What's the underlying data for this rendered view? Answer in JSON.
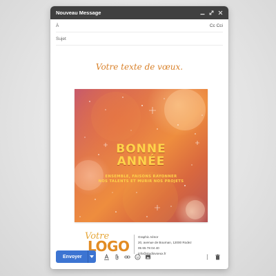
{
  "window": {
    "title": "Nouveau Message",
    "controls": [
      "minimize-icon",
      "expand-icon",
      "close-icon"
    ]
  },
  "fields": {
    "to_label": "À",
    "cc_label": "Cc Cci",
    "subject_label": "Sujet"
  },
  "body": {
    "greeting": "Votre texte de vœux.",
    "card": {
      "title_line1": "BONNE",
      "title_line2": "ANNÉE",
      "subtitle_line1": "ENSEMBLE, FAISONS RAYONNER",
      "subtitle_line2": "NOS TALENTS ET MURIR NOS PROJETS"
    },
    "signature": {
      "logo_script": "Votre",
      "logo_word": "LOGO",
      "name": "Graphic Aénor",
      "address": "20, avenue de Bournan, 12000 Rodez",
      "phone": "05 65 78 04 40",
      "email": "info@studiovoeux.fr"
    }
  },
  "footer": {
    "send_label": "Envoyer",
    "send_dropdown_icon": "caret-down-icon",
    "tools": [
      "format-text-icon",
      "attach-icon",
      "link-icon",
      "emoji-icon",
      "image-icon"
    ],
    "right_tools": [
      "more-options-icon",
      "trash-icon"
    ]
  },
  "colors": {
    "titlebar": "#404040",
    "send_button": "#3c74d2",
    "greeting": "#d9822b",
    "card_title": "#ffd34a"
  }
}
